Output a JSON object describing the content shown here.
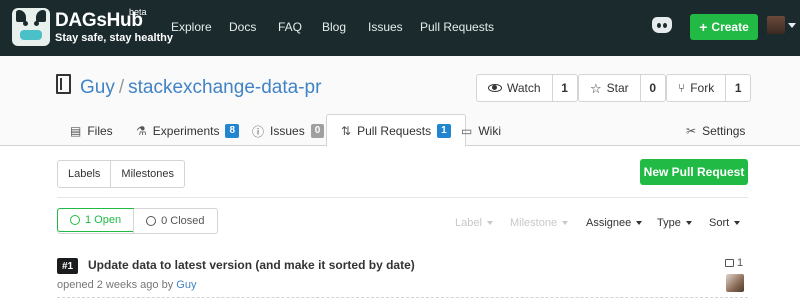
{
  "topnav": {
    "brand": "DAGsHub",
    "beta": "beta",
    "tagline": "Stay safe, stay healthy",
    "links": [
      "Explore",
      "Docs",
      "FAQ",
      "Blog",
      "Issues",
      "Pull Requests"
    ],
    "create_label": "Create"
  },
  "repo": {
    "owner": "Guy",
    "separator": "/",
    "name": "stackexchange-data-pr",
    "watch_label": "Watch",
    "watch_count": "1",
    "star_label": "Star",
    "star_count": "0",
    "fork_label": "Fork",
    "fork_count": "1"
  },
  "tabs": {
    "files": "Files",
    "experiments": "Experiments",
    "experiments_count": "8",
    "issues": "Issues",
    "issues_count": "0",
    "pull_requests": "Pull Requests",
    "pull_requests_count": "1",
    "wiki": "Wiki",
    "settings": "Settings"
  },
  "toolbar": {
    "labels": "Labels",
    "milestones": "Milestones",
    "new_pr": "New Pull Request"
  },
  "filters": {
    "open": "1 Open",
    "closed": "0 Closed",
    "label": "Label",
    "milestone": "Milestone",
    "assignee": "Assignee",
    "type": "Type",
    "sort": "Sort"
  },
  "pull_request": {
    "number": "#1",
    "title": "Update data to latest version (and make it sorted by date)",
    "meta_prefix": "opened 2 weeks ago by",
    "author": "Guy",
    "comments": "1"
  },
  "colors": {
    "nav_bg": "#1b2b2d",
    "green": "#21ba45",
    "link": "#4183c4",
    "badge_blue": "#2185d0"
  }
}
